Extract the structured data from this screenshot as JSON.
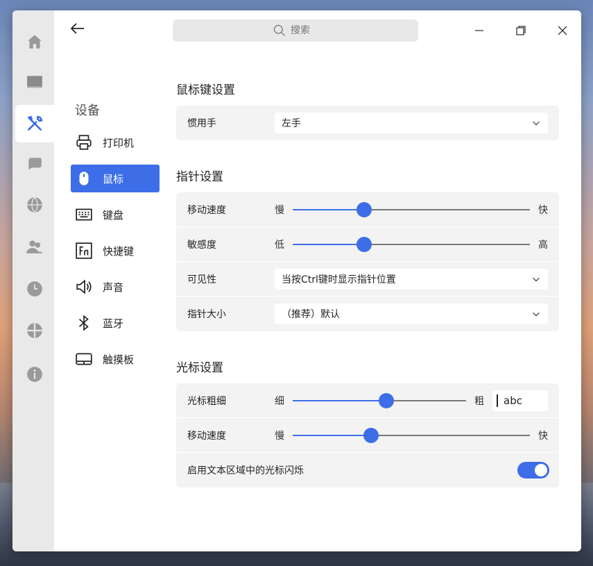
{
  "search": {
    "placeholder": "搜索"
  },
  "sidebar": {
    "title": "设备",
    "items": [
      {
        "label": "打印机"
      },
      {
        "label": "鼠标"
      },
      {
        "label": "键盘"
      },
      {
        "label": "快捷键"
      },
      {
        "label": "声音"
      },
      {
        "label": "蓝牙"
      },
      {
        "label": "触摸板"
      }
    ]
  },
  "sections": {
    "mouse_keys": {
      "title": "鼠标键设置",
      "handedness_label": "惯用手",
      "handedness_value": "左手"
    },
    "pointer": {
      "title": "指针设置",
      "speed_label": "移动速度",
      "speed_min": "慢",
      "speed_max": "快",
      "speed_value": 0.3,
      "sensitivity_label": "敏感度",
      "sensitivity_min": "低",
      "sensitivity_max": "高",
      "sensitivity_value": 0.3,
      "visibility_label": "可见性",
      "visibility_value": "当按Ctrl键时显示指针位置",
      "size_label": "指针大小",
      "size_value": "（推荐）默认"
    },
    "cursor": {
      "title": "光标设置",
      "thickness_label": "光标粗细",
      "thickness_min": "细",
      "thickness_max": "粗",
      "thickness_value": 0.54,
      "preview_text": "abc",
      "speed_label": "移动速度",
      "speed_min": "慢",
      "speed_max": "快",
      "speed_value": 0.33,
      "blink_label": "启用文本区域中的光标闪烁",
      "blink_enabled": true
    }
  },
  "colors": {
    "accent": "#3d6ee8",
    "rail": "#e9e9e9",
    "card": "#f3f3f3"
  }
}
